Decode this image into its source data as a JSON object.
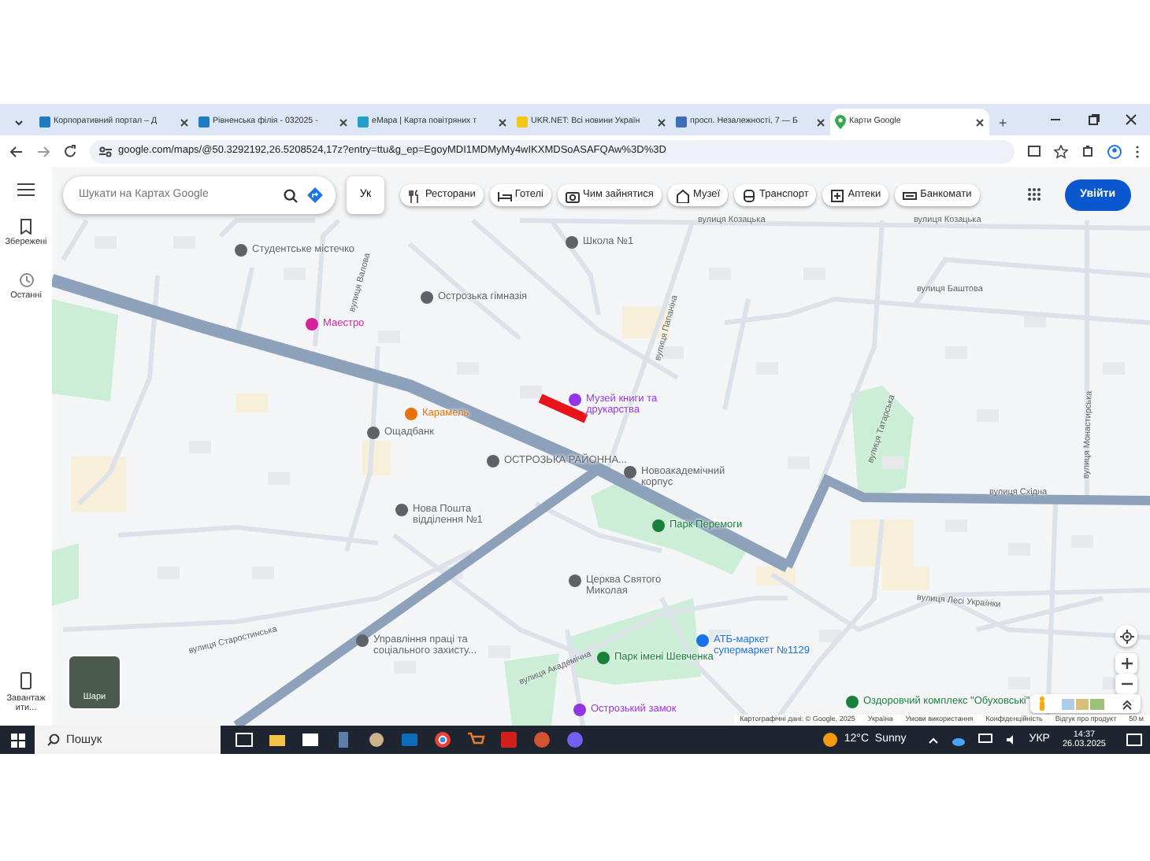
{
  "browser": {
    "tabs": [
      {
        "title": "Корпоративний портал – Д",
        "selected": false
      },
      {
        "title": "Рівненська філія - 032025 -",
        "selected": false
      },
      {
        "title": "eMapa | Карта повітряних т",
        "selected": false
      },
      {
        "title": "UKR.NET: Всі новини Україн",
        "selected": false
      },
      {
        "title": "просп. Незалежності, 7 — Б",
        "selected": false
      },
      {
        "title": "Карти Google",
        "selected": true
      }
    ],
    "new_tab": "+",
    "address": "google.com/maps/@50.3292192,26.5208524,17z?entry=ttu&g_ep=EgoyMDI1MDMyMy4wIKXMDSoASAFQAw%3D%3D"
  },
  "maps": {
    "search": {
      "placeholder": "Шукати на Картах Google"
    },
    "language": "Ук",
    "chips": [
      "Ресторани",
      "Готелі",
      "Чим зайнятися",
      "Музеї",
      "Транспорт",
      "Аптеки",
      "Банкомати"
    ],
    "sign_in": "Увійти",
    "sidebar": [
      "Збережені",
      "Останні"
    ],
    "download": "Завантажити...",
    "layers": "Шари",
    "places": [
      {
        "label": "Студентське містечко",
        "kind": "poi"
      },
      {
        "label": "Школа №1",
        "kind": "poi"
      },
      {
        "label": "Острозька гімназія",
        "kind": "poi"
      },
      {
        "label": "Маестро",
        "kind": "hotel"
      },
      {
        "label": "Карамель",
        "kind": "food"
      },
      {
        "label": "Музей книги та друкарства",
        "kind": "museum"
      },
      {
        "label": "Ощадбанк",
        "kind": "poi"
      },
      {
        "label": "ОСТРОЗЬКА РАЙОННА...",
        "kind": "poi"
      },
      {
        "label": "Новоакадемічний корпус",
        "kind": "poi"
      },
      {
        "label": "Нова Пошта відділення №1",
        "kind": "poi"
      },
      {
        "label": "Парк Перемоги",
        "kind": "park"
      },
      {
        "label": "Церква Святого Миколая",
        "kind": "poi"
      },
      {
        "label": "Управління праці та соціального захисту...",
        "kind": "poi"
      },
      {
        "label": "АТБ-маркет супермаркет №1129",
        "kind": "shop"
      },
      {
        "label": "Парк імені Шевченка",
        "kind": "park"
      },
      {
        "label": "Острозький замок",
        "kind": "museum"
      },
      {
        "label": "Оздоровчий комплекс \"Обуховські\"",
        "kind": "sport"
      }
    ],
    "streets": [
      "вулиця Козацька",
      "вулиця Козацька",
      "вулиця Баштова",
      "вулиця Східна",
      "вулиця Лесі Українки",
      "вулиця Старостинська",
      "вулиця Академічна",
      "вулиця Татарська",
      "вулиця Папаніна",
      "вулиця Валова",
      "вулиця Монастирська"
    ],
    "attribution": [
      "Картографічні дані: © Google, 2025",
      "Україна",
      "Умови використання",
      "Конфіденційність",
      "Відгук про продукт",
      "50 м"
    ]
  },
  "taskbar": {
    "search": "Пошук",
    "weather": "12°C  Sunny",
    "language": "УКР",
    "time": "14:37",
    "date": "26.03.2025"
  }
}
